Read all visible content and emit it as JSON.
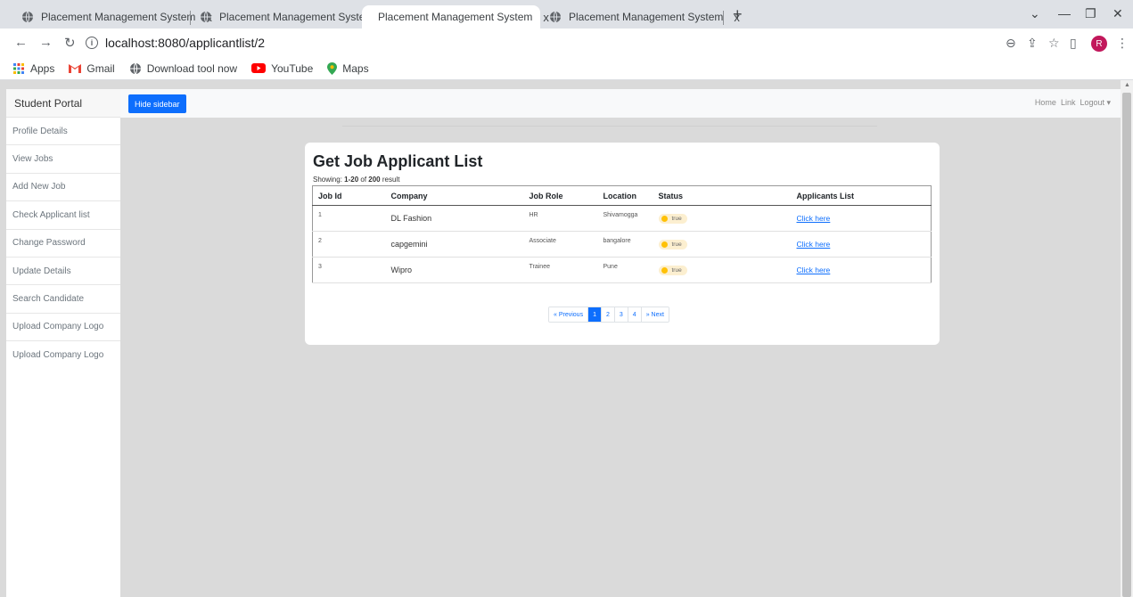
{
  "browser": {
    "tabs": [
      {
        "title": "Placement Management System",
        "active": false
      },
      {
        "title": "Placement Management System",
        "active": false
      },
      {
        "title": "Placement Management System",
        "active": true
      },
      {
        "title": "Placement Management System",
        "active": false
      }
    ],
    "tab_close": "x",
    "new_tab": "+",
    "url": "localhost:8080/applicantlist/2",
    "profile_initial": "R",
    "bookmarks": [
      {
        "label": "Apps",
        "icon": "apps-grid-icon"
      },
      {
        "label": "Gmail",
        "icon": "gmail-icon"
      },
      {
        "label": "Download tool now",
        "icon": "globe-icon"
      },
      {
        "label": "YouTube",
        "icon": "youtube-icon"
      },
      {
        "label": "Maps",
        "icon": "maps-icon"
      }
    ]
  },
  "sidebar": {
    "title": "Student Portal",
    "items": [
      {
        "label": "Profile Details"
      },
      {
        "label": "View Jobs"
      },
      {
        "label": "Add New Job"
      },
      {
        "label": "Check Applicant list"
      },
      {
        "label": "Change Password"
      },
      {
        "label": "Update Details"
      },
      {
        "label": "Search Candidate"
      },
      {
        "label": "Upload Company Logo"
      },
      {
        "label": "Upload Company Logo"
      }
    ]
  },
  "topbar": {
    "hide_sidebar": "Hide sidebar",
    "home": "Home",
    "link": "Link",
    "logout": "Logout ▾"
  },
  "main": {
    "title": "Get Job Applicant List",
    "showing_prefix": "Showing: ",
    "showing_range": "1-20",
    "showing_of": " of ",
    "showing_total": "200",
    "showing_suffix": " result",
    "columns": [
      "Job Id",
      "Company",
      "Job Role",
      "Location",
      "Status",
      "Applicants List"
    ],
    "rows": [
      {
        "id": "1",
        "company": "DL Fashion",
        "role": "HR",
        "location": "Shivamogga",
        "status": "true",
        "link": "Click here"
      },
      {
        "id": "2",
        "company": "capgemini",
        "role": "Associate",
        "location": "bangalore",
        "status": "true",
        "link": "Click here"
      },
      {
        "id": "3",
        "company": "Wipro",
        "role": "Trainee",
        "location": "Pune",
        "status": "true",
        "link": "Click here"
      }
    ],
    "pagination": {
      "previous": "« Previous",
      "pages": [
        "1",
        "2",
        "3",
        "4"
      ],
      "next": "» Next"
    }
  },
  "colors": {
    "primary": "#0d6efd",
    "badge_dot": "#ffc107",
    "badge_bg": "#fcefd0",
    "page_bg": "#dadada"
  }
}
